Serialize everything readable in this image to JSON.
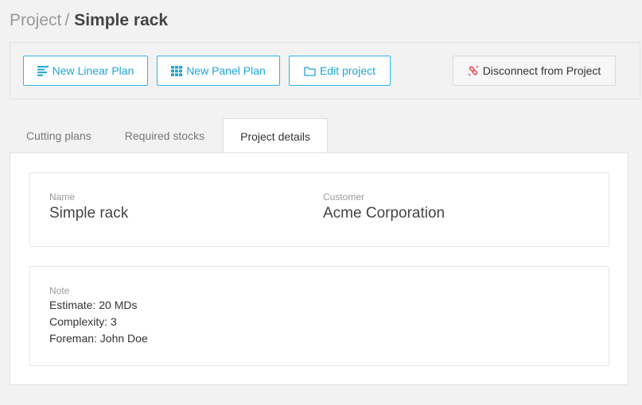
{
  "breadcrumb": {
    "parent": "Project",
    "separator": "/",
    "current": "Simple rack"
  },
  "toolbar": {
    "new_linear_plan": "New Linear Plan",
    "new_panel_plan": "New Panel Plan",
    "edit_project": "Edit project",
    "disconnect": "Disconnect from Project"
  },
  "tabs": [
    {
      "label": "Cutting plans"
    },
    {
      "label": "Required stocks"
    },
    {
      "label": "Project details",
      "active": true
    }
  ],
  "details": {
    "name_label": "Name",
    "name_value": "Simple rack",
    "customer_label": "Customer",
    "customer_value": "Acme Corporation",
    "note_label": "Note",
    "note_lines": [
      "Estimate: 20 MDs",
      "Complexity: 3",
      "Foreman: John Doe"
    ]
  },
  "colors": {
    "accent": "#1fa4d8",
    "danger": "#e8474c"
  },
  "icons": {
    "linear_plan": "align-left-icon",
    "panel_plan": "grid-icon",
    "edit_project": "folder-icon",
    "disconnect": "unlink-icon"
  }
}
